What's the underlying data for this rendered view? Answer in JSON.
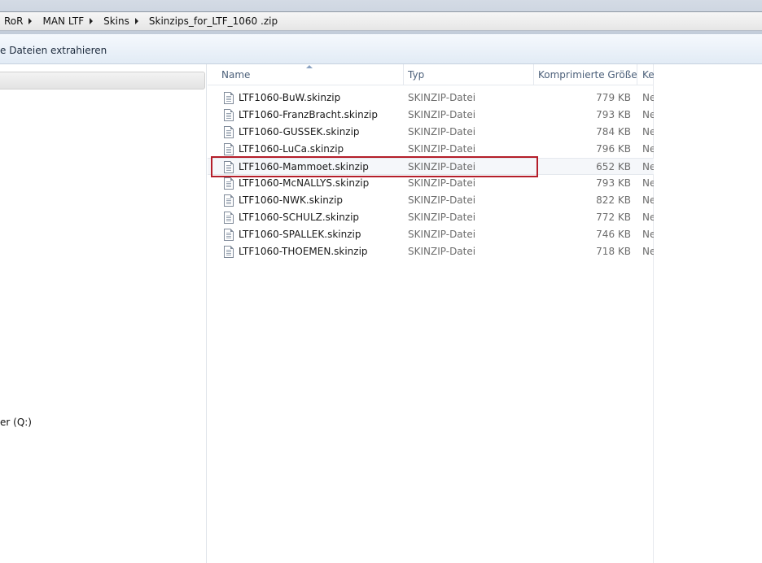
{
  "breadcrumb": [
    "RoR",
    "MAN LTF",
    "Skins",
    "Skinzips_for_LTF_1060 .zip"
  ],
  "commandbar": {
    "extract_label": "e Dateien extrahieren"
  },
  "navpane": {
    "drive_label": "er (Q:)"
  },
  "columns": {
    "name": "Name",
    "type": "Typ",
    "size": "Komprimierte Größe",
    "col4": "Ke"
  },
  "files": [
    {
      "name": "LTF1060-BuW.skinzip",
      "type": "SKINZIP-Datei",
      "size": "779 KB",
      "col4": "Ne"
    },
    {
      "name": "LTF1060-FranzBracht.skinzip",
      "type": "SKINZIP-Datei",
      "size": "793 KB",
      "col4": "Ne"
    },
    {
      "name": "LTF1060-GUSSEK.skinzip",
      "type": "SKINZIP-Datei",
      "size": "784 KB",
      "col4": "Ne"
    },
    {
      "name": "LTF1060-LuCa.skinzip",
      "type": "SKINZIP-Datei",
      "size": "796 KB",
      "col4": "Ne"
    },
    {
      "name": "LTF1060-Mammoet.skinzip",
      "type": "SKINZIP-Datei",
      "size": "652 KB",
      "col4": "Ne"
    },
    {
      "name": "LTF1060-McNALLYS.skinzip",
      "type": "SKINZIP-Datei",
      "size": "793 KB",
      "col4": "Ne"
    },
    {
      "name": "LTF1060-NWK.skinzip",
      "type": "SKINZIP-Datei",
      "size": "822 KB",
      "col4": "Ne"
    },
    {
      "name": "LTF1060-SCHULZ.skinzip",
      "type": "SKINZIP-Datei",
      "size": "772 KB",
      "col4": "Ne"
    },
    {
      "name": "LTF1060-SPALLEK.skinzip",
      "type": "SKINZIP-Datei",
      "size": "746 KB",
      "col4": "Ne"
    },
    {
      "name": "LTF1060-THOEMEN.skinzip",
      "type": "SKINZIP-Datei",
      "size": "718 KB",
      "col4": "Ne"
    }
  ],
  "icons": {
    "file": "document-icon",
    "sort": "sort-ascending-icon",
    "separator": "chevron-right-icon"
  },
  "colors": {
    "highlight_box": "#b41e2a",
    "header_text": "#4c607a"
  }
}
